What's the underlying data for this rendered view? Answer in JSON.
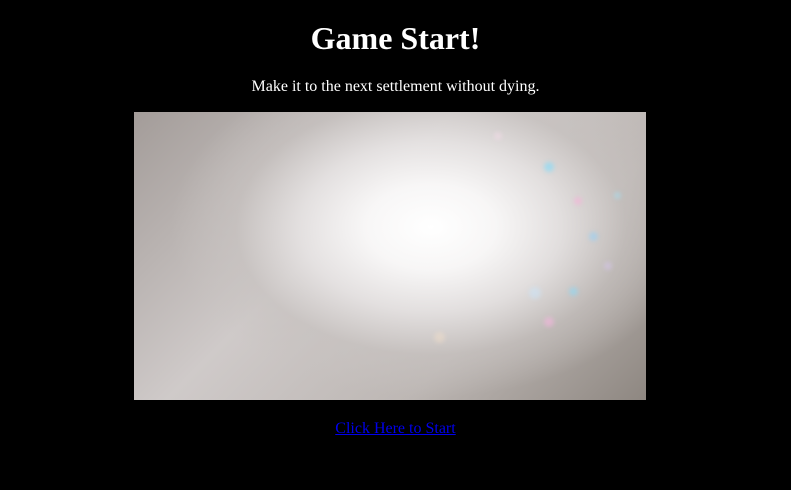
{
  "page": {
    "title": "Game Start!",
    "subtitle": "Make it to the next settlement without dying.",
    "start_link": "Click Here to Start"
  },
  "scene": {
    "image": "bright-blurred-light-image"
  },
  "colors": {
    "background": "#000000",
    "text": "#ffffff",
    "link": "#0000ee"
  }
}
